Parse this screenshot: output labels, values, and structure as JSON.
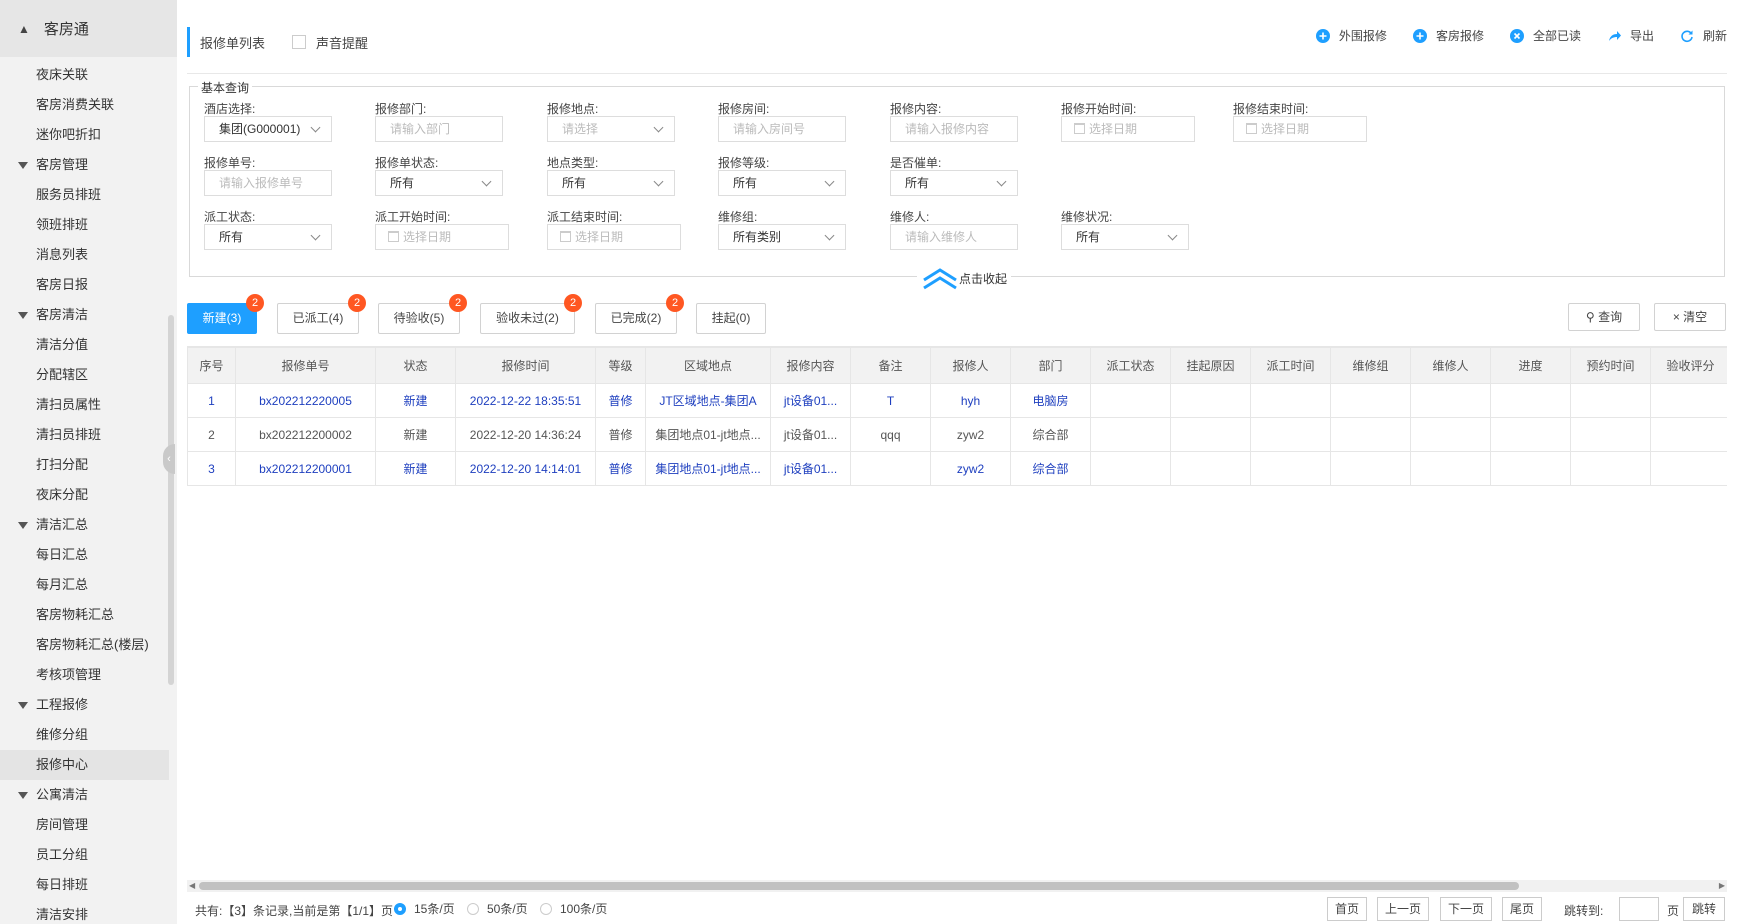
{
  "sidebar": {
    "title": "客房通",
    "items": [
      {
        "label": "夜床关联",
        "group": false
      },
      {
        "label": "客房消费关联",
        "group": false
      },
      {
        "label": "迷你吧折扣",
        "group": false
      },
      {
        "label": "客房管理",
        "group": true
      },
      {
        "label": "服务员排班",
        "group": false
      },
      {
        "label": "领班排班",
        "group": false
      },
      {
        "label": "消息列表",
        "group": false
      },
      {
        "label": "客房日报",
        "group": false
      },
      {
        "label": "客房清洁",
        "group": true
      },
      {
        "label": "清洁分值",
        "group": false
      },
      {
        "label": "分配辖区",
        "group": false
      },
      {
        "label": "清扫员属性",
        "group": false
      },
      {
        "label": "清扫员排班",
        "group": false
      },
      {
        "label": "打扫分配",
        "group": false
      },
      {
        "label": "夜床分配",
        "group": false
      },
      {
        "label": "清洁汇总",
        "group": true
      },
      {
        "label": "每日汇总",
        "group": false
      },
      {
        "label": "每月汇总",
        "group": false
      },
      {
        "label": "客房物耗汇总",
        "group": false
      },
      {
        "label": "客房物耗汇总(楼层)",
        "group": false
      },
      {
        "label": "考核项管理",
        "group": false
      },
      {
        "label": "工程报修",
        "group": true
      },
      {
        "label": "维修分组",
        "group": false
      },
      {
        "label": "报修中心",
        "group": false,
        "active": true
      },
      {
        "label": "公寓清洁",
        "group": true
      },
      {
        "label": "房间管理",
        "group": false
      },
      {
        "label": "员工分组",
        "group": false
      },
      {
        "label": "每日排班",
        "group": false
      },
      {
        "label": "清洁安排",
        "group": false
      }
    ]
  },
  "header": {
    "title": "报修单列表",
    "sound_label": "声音提醒",
    "actions": [
      {
        "label": "外围报修",
        "icon": "plus-circle-icon"
      },
      {
        "label": "客房报修",
        "icon": "plus-circle-icon"
      },
      {
        "label": "全部已读",
        "icon": "x-circle-icon"
      },
      {
        "label": "导出",
        "icon": "share-arrow-icon"
      },
      {
        "label": "刷新",
        "icon": "refresh-icon"
      }
    ]
  },
  "query": {
    "legend": "基本查询",
    "collapse_label": "点击收起",
    "fields": {
      "hotel": {
        "label": "酒店选择:",
        "value": "集团(G000001)"
      },
      "dept": {
        "label": "报修部门:",
        "placeholder": "请输入部门"
      },
      "place": {
        "label": "报修地点:",
        "placeholder": "请选择"
      },
      "room": {
        "label": "报修房间:",
        "placeholder": "请输入房间号"
      },
      "content": {
        "label": "报修内容:",
        "placeholder": "请输入报修内容"
      },
      "start": {
        "label": "报修开始时间:",
        "placeholder": "选择日期"
      },
      "end": {
        "label": "报修结束时间:",
        "placeholder": "选择日期"
      },
      "orderno": {
        "label": "报修单号:",
        "placeholder": "请输入报修单号"
      },
      "status": {
        "label": "报修单状态:",
        "value": "所有"
      },
      "ptype": {
        "label": "地点类型:",
        "value": "所有"
      },
      "level": {
        "label": "报修等级:",
        "value": "所有"
      },
      "urge": {
        "label": "是否催单:",
        "value": "所有"
      },
      "dispatch": {
        "label": "派工状态:",
        "value": "所有"
      },
      "dstart": {
        "label": "派工开始时间:",
        "placeholder": "选择日期"
      },
      "dend": {
        "label": "派工结束时间:",
        "placeholder": "选择日期"
      },
      "group": {
        "label": "维修组:",
        "value": "所有类别"
      },
      "fixer": {
        "label": "维修人:",
        "placeholder": "请输入维修人"
      },
      "fstatus": {
        "label": "维修状况:",
        "value": "所有"
      }
    }
  },
  "tabs": [
    {
      "label": "新建(3)",
      "badge": "2"
    },
    {
      "label": "已派工(4)",
      "badge": "2"
    },
    {
      "label": "待验收(5)",
      "badge": "2"
    },
    {
      "label": "验收未过(2)",
      "badge": "2"
    },
    {
      "label": "已完成(2)",
      "badge": "2"
    },
    {
      "label": "挂起(0)",
      "badge": ""
    }
  ],
  "buttons": {
    "search": "查询",
    "clear": "清空"
  },
  "table": {
    "columns": [
      "序号",
      "报修单号",
      "状态",
      "报修时间",
      "等级",
      "区域地点",
      "报修内容",
      "备注",
      "报修人",
      "部门",
      "派工状态",
      "挂起原因",
      "派工时间",
      "维修组",
      "维修人",
      "进度",
      "预约时间",
      "验收评分"
    ],
    "rows": [
      {
        "cells": [
          "1",
          "bx202212220005",
          "新建",
          "2022-12-22 18:35:51",
          "普修",
          "JT区域地点-集团A",
          "jt设备01...",
          "T",
          "hyh",
          "电脑房",
          "",
          "",
          "",
          "",
          "",
          "",
          "",
          ""
        ],
        "highlight": true
      },
      {
        "cells": [
          "2",
          "bx202212200002",
          "新建",
          "2022-12-20 14:36:24",
          "普修",
          "集团地点01-jt地点...",
          "jt设备01...",
          "qqq",
          "zyw2",
          "综合部",
          "",
          "",
          "",
          "",
          "",
          "",
          "",
          ""
        ],
        "highlight": false
      },
      {
        "cells": [
          "3",
          "bx202212200001",
          "新建",
          "2022-12-20 14:14:01",
          "普修",
          "集团地点01-jt地点...",
          "jt设备01...",
          "",
          "zyw2",
          "综合部",
          "",
          "",
          "",
          "",
          "",
          "",
          "",
          ""
        ],
        "highlight": true
      }
    ]
  },
  "pager": {
    "info": "共有:【3】条记录,当前是第【1/1】页",
    "sizes": [
      "15条/页",
      "50条/页",
      "100条/页"
    ],
    "first": "首页",
    "prev": "上一页",
    "next": "下一页",
    "last": "尾页",
    "jump_label": "跳转到:",
    "page_unit": "页",
    "jump_btn": "跳转"
  },
  "colors": {
    "accent": "#1e9fff",
    "badge": "#ff5722",
    "link": "#1e3fbf"
  }
}
